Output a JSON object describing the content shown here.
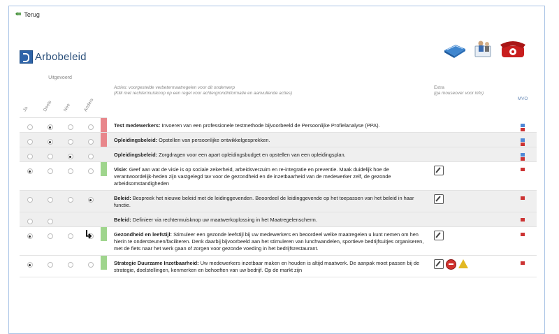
{
  "nav": {
    "back_label": "Terug"
  },
  "page": {
    "title": "Arbobeleid"
  },
  "header_icons": [
    "book-icon",
    "people-icon",
    "phone-icon"
  ],
  "table": {
    "group_label": "Uitgevoerd",
    "status_columns": [
      "Ja",
      "Deels",
      "Nee",
      "Anders"
    ],
    "action_header": "Acties: voorgestelde verbetermaatregelen voor dit onderwerp",
    "action_subheader": "(Klik met rechtermuisknop op een regel voor achtergrondinformatie en aanvullende acties)",
    "extra_header": "Extra",
    "extra_subheader": "(ga mouseover voor info)",
    "mvo_header": "MVO",
    "rows": [
      {
        "title": "Test medewerkers:",
        "text": "Invoeren van een professionele testmethode bijvoorbeeld de Persoonlijke Profielanalyse (PPA).",
        "selected": 1,
        "bar": "#e8868b",
        "mvo": [
          "#4f88d6",
          "#cc3333"
        ]
      },
      {
        "title": "Opleidingsbeleid:",
        "text": "Opstellen van persoonlijke ontwikkelgesprekken.",
        "selected": 1,
        "bar": "#e8868b",
        "mvo": [
          "#4f88d6",
          "#cc3333"
        ]
      },
      {
        "title": "Opleidingsbeleid:",
        "text": "Zorgdragen voor een apart opleidingsbudget en opstellen van een opleidingsplan.",
        "selected": 2,
        "bar": "",
        "mvo": [
          "#4f88d6",
          "#cc3333"
        ]
      },
      {
        "title": "Visie:",
        "text": "Geef aan wat de visie is op sociale zekerheid, arbeidsverzuim en re-integratie en preventie. Maak duidelijk hoe de verantwoordelijk-heden zijn vastgelegd tav voor de gezondheid en de inzetbaarheid van de medewerker zelf, de gezonde arbeidsomstandigheden",
        "selected": 0,
        "bar": "#9fd58d",
        "mvo": [
          "#cc3333"
        ]
      },
      {
        "title": "Beleid:",
        "text": "Bespreek het nieuwe beleid met de leidinggevenden. Beoordeel de leidinggevende op het toepassen van het beleid in haar functie.",
        "selected": 3,
        "bar": "",
        "mvo": [
          "#cc3333"
        ]
      },
      {
        "title": "Beleid:",
        "text": "Definieer via rechtermuisknop uw maatwerkoplossing in het Maatregelenscherm.",
        "selected": -1,
        "bar": "",
        "mvo": [
          "#cc3333"
        ]
      },
      {
        "title": "Gezondheid en leefstijl:",
        "text": "Stimuleer een gezonde leefstijl bij uw medewerkers en beoordeel welke maatregelen u kunt nemen om hen hierin te ondersteunen/faciliteren. Denk daarbij bijvoorbeeld aan het stimuleren van lunchwandelen, sportieve bedrijfsuitjes organiseren, met de fiets naar het werk gaan of zorgen voor gezonde voeding in het bedrijfsrestaurant.",
        "selected": 0,
        "bar": "#9fd58d",
        "mvo": [
          "#cc3333"
        ]
      },
      {
        "title": "Strategie Duurzame Inzetbaarheid:",
        "text": "Uw medewerkers inzetbaar maken en houden is altijd maatwerk. De aanpak moet passen bij de strategie, doelstellingen, kenmerken en behoeften van uw bedrijf. Op de markt zijn",
        "selected": 0,
        "bar": "#9fd58d",
        "mvo": [
          "#cc3333"
        ]
      }
    ]
  }
}
